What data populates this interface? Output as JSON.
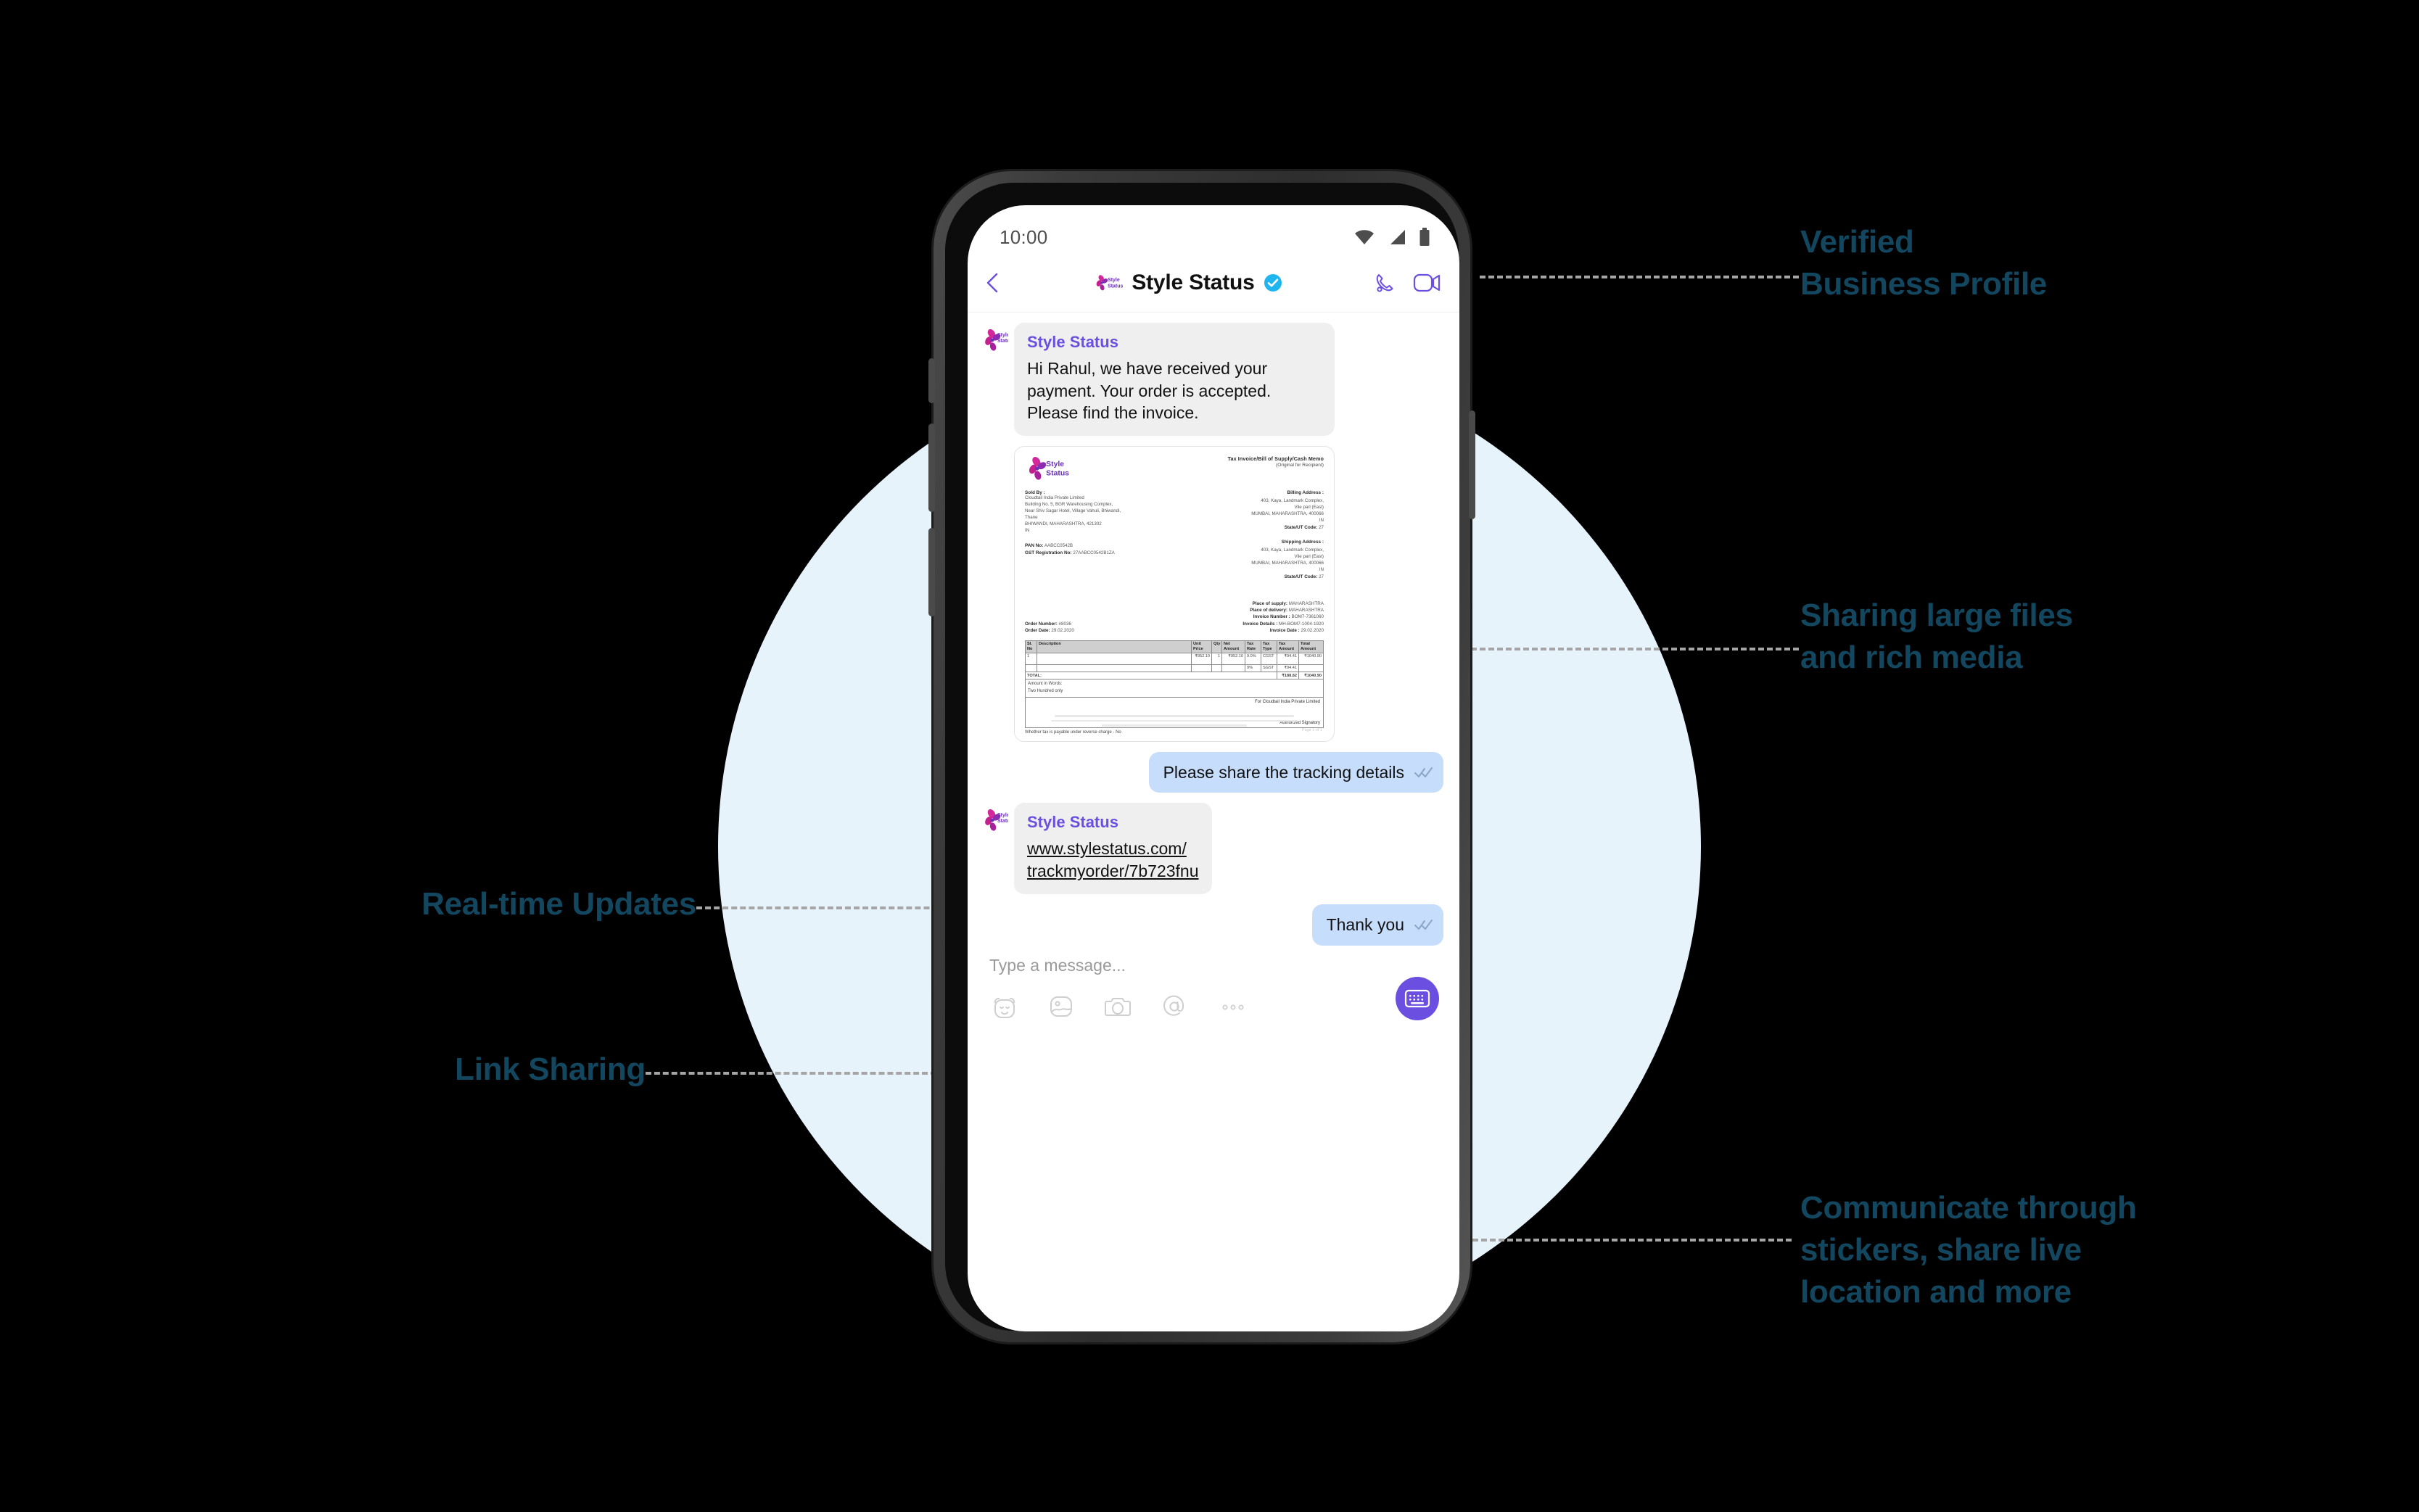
{
  "statusbar": {
    "time": "10:00",
    "icons": [
      "wifi-icon",
      "signal-icon",
      "battery-icon"
    ]
  },
  "chat_header": {
    "back_icon": "back-chevron-icon",
    "logo": "style-status-logo",
    "title": "Style Status",
    "verified_badge": "verified-check-icon",
    "call_icon": "phone-call-icon",
    "video_icon": "video-call-icon"
  },
  "messages": [
    {
      "type": "incoming",
      "sender": "Style Status",
      "text": "Hi Rahul, we have received your payment. Your order is accepted. Please find the invoice."
    },
    {
      "type": "attachment",
      "kind": "invoice-document"
    },
    {
      "type": "outgoing",
      "text": "Please share the tracking details",
      "status": "read"
    },
    {
      "type": "incoming-link",
      "sender": "Style Status",
      "link_line1": "www.stylestatus.com/",
      "link_line2": "trackmyorder/7b723fnu"
    },
    {
      "type": "outgoing",
      "text": "Thank you",
      "status": "read"
    }
  ],
  "invoice": {
    "brand": "Style Status",
    "title_line1": "Tax Invoice/Bill of Supply/Cash Memo",
    "title_line2": "(Original for Recipient)",
    "sold_by_label": "Sold By :",
    "sold_by_lines": [
      "Cloudtail India Private Limited",
      "Building No. 5, BGR Warehousing Complex,",
      "Near Shiv Sagar Hotel, Village Vahuli, Bhiwandi,",
      "Thane",
      "BHIWANDI, MAHARASHTRA, 421302",
      "IN"
    ],
    "pan_label": "PAN No:",
    "pan_value": "AABCC0542B",
    "gst_label": "GST Registration No:",
    "gst_value": "27AABCC0542B1ZA",
    "billing_label": "Billing Address :",
    "billing_lines": [
      "403, Kaya, Landmark Complex,",
      "Vile parl (East)",
      "MUMBAI, MAHARASHTRA, 400066",
      "IN"
    ],
    "billing_state_label": "State/UT Code:",
    "billing_state_value": "27",
    "shipping_label": "Shipping Address :",
    "shipping_lines": [
      "403, Kaya, Landmark Complex,",
      "Vile parl (East)",
      "MUMBAI, MAHARASHTRA, 400066",
      "IN"
    ],
    "shipping_state_label": "State/UT Code:",
    "shipping_state_value": "27",
    "place_of_supply_label": "Place of supply:",
    "place_of_supply_value": "MAHARASHTRA",
    "place_of_delivery_label": "Place of delivery:",
    "place_of_delivery_value": "MAHARASHTRA",
    "invoice_number_label": "Invoice Number :",
    "invoice_number_value": "BOM7-7361060",
    "invoice_details_label": "Invoice Details :",
    "invoice_details_value": "MH-BOM7-1004-1920",
    "invoice_date_label": "Invoice Date :",
    "invoice_date_value": "29.02.2020",
    "order_number_label": "Order Number:",
    "order_number_value": "#8036",
    "order_date_label": "Order Date:",
    "order_date_value": "29.02.2020",
    "table_headers": [
      "Sl. No",
      "Description",
      "Unit Price",
      "Qty",
      "Net Amount",
      "Tax Rate",
      "Tax Type",
      "Tax Amount",
      "Total Amount"
    ],
    "table_rows": [
      {
        "sl": "1",
        "desc": "",
        "unit_price": "₹952.10",
        "qty": "1",
        "net_amount": "₹952.10",
        "tax_rate": "9.0%",
        "tax_type": "CGST",
        "tax_amount": "₹94.41",
        "total": "₹1040.90"
      },
      {
        "sl": "",
        "desc": "",
        "unit_price": "",
        "qty": "",
        "net_amount": "",
        "tax_rate": "9%",
        "tax_type": "SGST",
        "tax_amount": "₹94.41",
        "total": ""
      }
    ],
    "total_label": "TOTAL:",
    "total_tax": "₹188.82",
    "total_amount": "₹1040.90",
    "amount_in_words_label": "Amount in Words:",
    "amount_in_words_value": "Two Hundred only",
    "for_company": "For Cloudtail India Private Limited",
    "authorized_signatory": "Authorized Signatory",
    "reverse_charge": "Whether tax is payable under reverse charge - No",
    "page_number": "Page 1 of 1"
  },
  "composer": {
    "placeholder": "Type a message...",
    "tools": [
      "sticker-icon",
      "gallery-icon",
      "camera-icon",
      "mention-icon",
      "more-icon"
    ],
    "keyboard_button": "keyboard-icon"
  },
  "annotations": {
    "verified_profile": "Verified\nBusiness Profile",
    "verified_profile_l1": "Verified",
    "verified_profile_l2": "Business Profile",
    "large_files_l1": "Sharing large files",
    "large_files_l2": "and rich media",
    "realtime": "Real-time Updates",
    "link_sharing": "Link Sharing",
    "stickers_l1": "Communicate through",
    "stickers_l2": "stickers, share live",
    "stickers_l3": "location and more"
  },
  "colors": {
    "background": "#000000",
    "circle": "#e7f3fb",
    "annotation_text": "#12475f",
    "brand_purple": "#6b4fe0",
    "brand_pink": "#d2289a",
    "outgoing_bubble": "#c6ddfb",
    "incoming_bubble": "#efefef",
    "verified_blue": "#1fb6ef"
  }
}
